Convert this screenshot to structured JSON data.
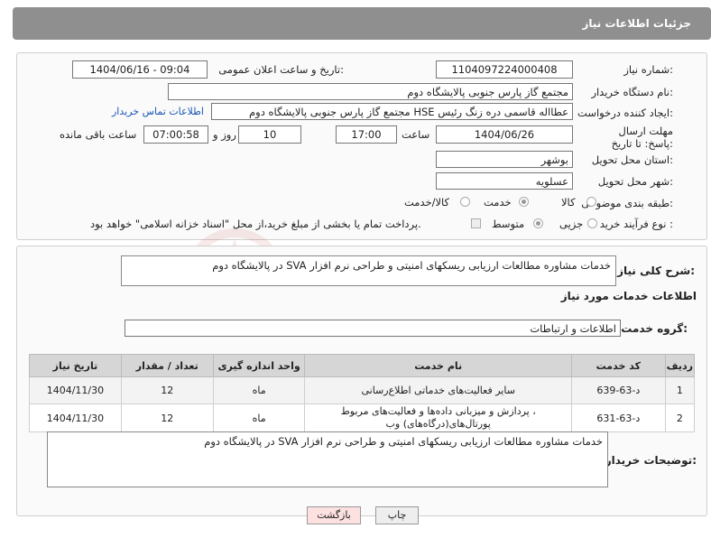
{
  "header": {
    "title": "جزئیات اطلاعات نیاز"
  },
  "fields": {
    "need_number_label": "شماره نیاز:",
    "need_number": "1104097224000408",
    "announce_label": "تاریخ و ساعت اعلان عمومی:",
    "announce_value": "1404/06/16 - 09:04",
    "buyer_org_label": "نام دستگاه خریدار:",
    "buyer_org": "مجتمع گاز پارس جنوبی  پالایشگاه دوم",
    "creator_label": "ایجاد کننده درخواست:",
    "creator": "عطااله قاسمی دره زنگ رئیس HSE مجتمع گاز پارس جنوبی  پالایشگاه دوم",
    "contact_link": "اطلاعات تماس خریدار",
    "deadline_label": "مهلت ارسال پاسخ: تا تاریخ:",
    "deadline_date": "1404/06/26",
    "time_label": "ساعت",
    "deadline_time": "17:00",
    "days_value": "10",
    "days_label": "روز و",
    "remaining_time": "07:00:58",
    "remaining_label": "ساعت باقی مانده",
    "province_label": "استان محل تحویل:",
    "province": "بوشهر",
    "city_label": "شهر محل تحویل:",
    "city": "عسلویه",
    "category_label": "طبقه بندی موضوعی:",
    "category_options": [
      "کالا",
      "خدمت",
      "کالا/خدمت"
    ],
    "process_label": "نوع فرآیند خرید :",
    "process_options": [
      "جزیی",
      "متوسط"
    ],
    "payment_note": "پرداخت تمام یا بخشی از مبلغ خرید،از محل \"اسناد خزانه اسلامی\" خواهد بود."
  },
  "description": {
    "label": "شرح کلی نیاز:",
    "text": "خدمات مشاوره مطالعات ارزیابی ریسکهای امنیتی و طراحی نرم افزار SVA در پالایشگاه دوم"
  },
  "services": {
    "title": "اطلاعات خدمات مورد نیاز",
    "group_label": "گروه خدمت:",
    "group_value": "اطلاعات و ارتباطات",
    "columns": [
      "ردیف",
      "کد خدمت",
      "نام خدمت",
      "واحد اندازه گیری",
      "تعداد / مقدار",
      "تاریخ نیاز"
    ],
    "rows": [
      {
        "idx": "1",
        "code": "د-63-639",
        "name": "سایر فعالیت‌های خدماتی اطلاع‌رسانی",
        "unit": "ماه",
        "qty": "12",
        "date": "1404/11/30"
      },
      {
        "idx": "2",
        "code": "د-63-631",
        "name_line1": "پردازش و میزبانی داده‌ها و فعالیت‌های مربوط ،",
        "name_line2": "پورتال‌های(درگاه‌های) وب",
        "unit": "ماه",
        "qty": "12",
        "date": "1404/11/30"
      }
    ]
  },
  "buyer_notes": {
    "label": "توضیحات خریدار:",
    "text": "خدمات مشاوره مطالعات ارزیابی ریسکهای امنیتی و طراحی نرم افزار SVA در پالایشگاه دوم"
  },
  "buttons": {
    "print": "چاپ",
    "back": "بازگشت"
  },
  "colors": {
    "header_bg": "#8f8f8f",
    "link": "#1a55b5",
    "back_button_bg": "#fde0e0",
    "table_header_bg": "#d6d6d6"
  }
}
